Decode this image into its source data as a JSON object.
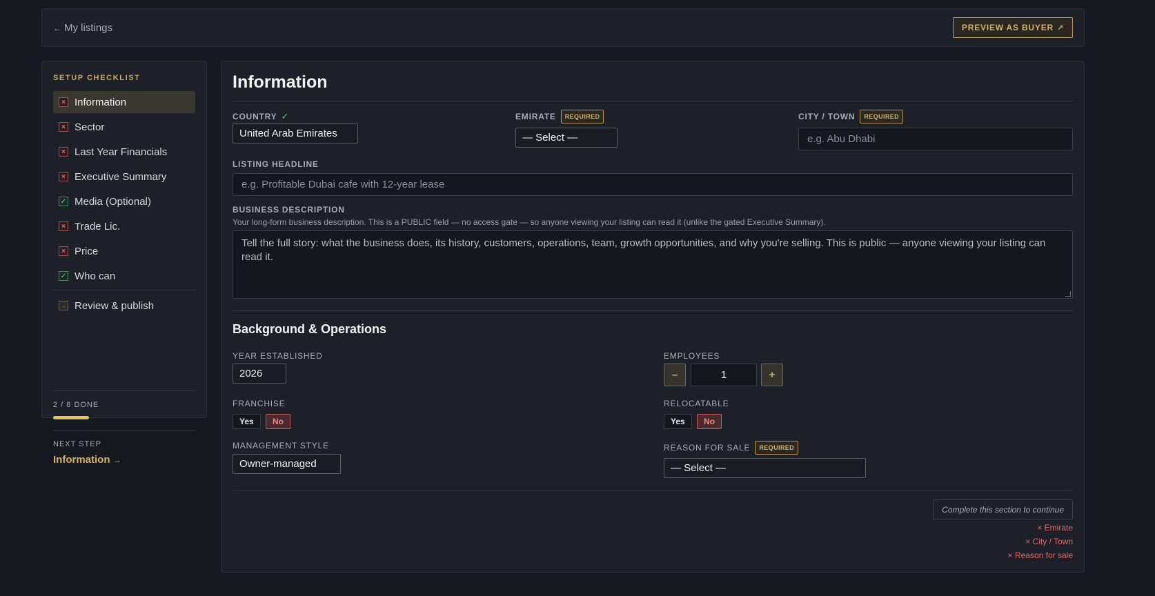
{
  "topbar": {
    "back_arrow": "←",
    "back_label": "My listings",
    "preview_label": "PREVIEW AS BUYER",
    "preview_icon": "↗"
  },
  "sidebar": {
    "title": "SETUP CHECKLIST",
    "items": [
      {
        "label": "Information",
        "status": "incomplete",
        "mark": "×"
      },
      {
        "label": "Sector",
        "status": "incomplete",
        "mark": "×"
      },
      {
        "label": "Last Year Financials",
        "status": "incomplete",
        "mark": "×"
      },
      {
        "label": "Executive Summary",
        "status": "incomplete",
        "mark": "×"
      },
      {
        "label": "Media (Optional)",
        "status": "complete",
        "mark": "✓"
      },
      {
        "label": "Trade Lic.",
        "status": "incomplete",
        "mark": "×"
      },
      {
        "label": "Price",
        "status": "incomplete",
        "mark": "×"
      },
      {
        "label": "Who can",
        "status": "complete",
        "mark": "✓"
      }
    ],
    "review": {
      "label": "Review & publish",
      "mark": "→"
    },
    "progress_label": "2 / 8 DONE",
    "progress_fraction": 0.25,
    "next_step_label": "NEXT STEP",
    "next_step_link": "Information",
    "next_step_arrow": "→"
  },
  "main": {
    "title": "Information",
    "country": {
      "label": "COUNTRY",
      "check": "✓",
      "value": "United Arab Emirates"
    },
    "emirate": {
      "label": "EMIRATE",
      "required": "REQUIRED",
      "value": "— Select —"
    },
    "city": {
      "label": "CITY / TOWN",
      "required": "REQUIRED",
      "placeholder": "e.g. Abu Dhabi"
    },
    "headline": {
      "label": "LISTING HEADLINE",
      "placeholder": "e.g. Profitable Dubai cafe with 12-year lease"
    },
    "description": {
      "label": "BUSINESS DESCRIPTION",
      "note": "Your long-form business description. This is a PUBLIC field — no access gate — so anyone viewing your listing can read it (unlike the gated Executive Summary).",
      "placeholder": "Tell the full story: what the business does, its history, customers, operations, team, growth opportunities, and why you're selling. This is public — anyone viewing your listing can read it."
    },
    "section2_title": "Background & Operations",
    "year": {
      "label": "YEAR ESTABLISHED",
      "value": "2026"
    },
    "employees": {
      "label": "EMPLOYEES",
      "minus": "–",
      "value": "1",
      "plus": "+"
    },
    "franchise": {
      "label": "FRANCHISE",
      "yes": "Yes",
      "no": "No",
      "selected": "No"
    },
    "relocatable": {
      "label": "RELOCATABLE",
      "yes": "Yes",
      "no": "No",
      "selected": "No"
    },
    "management": {
      "label": "MANAGEMENT STYLE",
      "value": "Owner-managed"
    },
    "reason": {
      "label": "REASON FOR SALE",
      "required": "REQUIRED",
      "value": "— Select —"
    },
    "complete_note": "Complete this section to continue",
    "missing": [
      "× Emirate",
      "× City / Town",
      "× Reason for sale"
    ]
  },
  "colors": {
    "background": "#16181f",
    "panel": "#1d2029",
    "accent_gold": "#d3b26a",
    "error_red": "#e36a6a",
    "success_green": "#5cc27b"
  }
}
